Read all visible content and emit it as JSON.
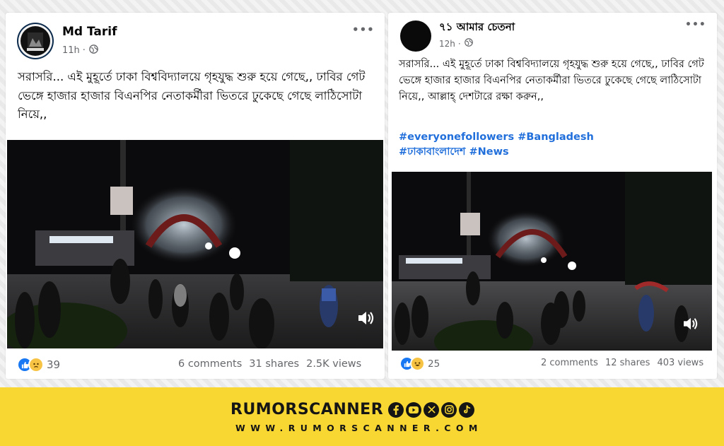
{
  "post_left": {
    "author": "Md Tarif",
    "time": "11h",
    "dot": "·",
    "menu": "•••",
    "text": "সরাসরি... এই মুহূর্তে ঢাকা বিশ্ববিদ্যালয়ে গৃহযুদ্ধ শুরু হয়ে গেছে,, ঢাবির গেট ভেঙ্গে হাজার হাজার বিএনপির নেতাকর্মীরা ভিতরে ঢুকেছে গেছে লাঠিসোটা নিয়ে,,",
    "reaction_count": "39",
    "comments": "6 comments",
    "shares": "31 shares",
    "views": "2.5K views"
  },
  "post_right": {
    "author": "৭১ আমার চেতনা",
    "time": "12h",
    "dot": "·",
    "menu": "•••",
    "text": "সরাসরি... এই মুহূর্তে ঢাকা বিশ্ববিদ্যালয়ে গৃহযুদ্ধ শুরু হয়ে গেছে,, ঢাবির গেট ভেঙ্গে হাজার হাজার বিএনপির নেতাকর্মীরা ভিতরে ঢুকেছে গেছে লাঠিসোটা নিয়ে,, আল্লাহ্‌ দেশটারে রক্ষা করুন,,",
    "hashtags_line1": "#everyonefollowers #Bangladesh",
    "hashtags_line2": "#ঢাকাবাংলাদেশ #News",
    "reaction_count": "25",
    "comments": "2 comments",
    "shares": "12 shares",
    "views": "403 views"
  },
  "banner": {
    "brand": "RUMORSCANNER",
    "url": "WWW.RUMORSCANNER.COM"
  },
  "colors": {
    "link": "#216fdb",
    "muted": "#65676b",
    "banner": "#f8d732",
    "like_blue": "#1877f2"
  },
  "icons": [
    "globe-icon",
    "more-options-icon",
    "speaker-icon",
    "like-icon",
    "sad-icon",
    "haha-icon",
    "facebook-icon",
    "youtube-icon",
    "x-icon",
    "instagram-icon",
    "tiktok-icon"
  ]
}
